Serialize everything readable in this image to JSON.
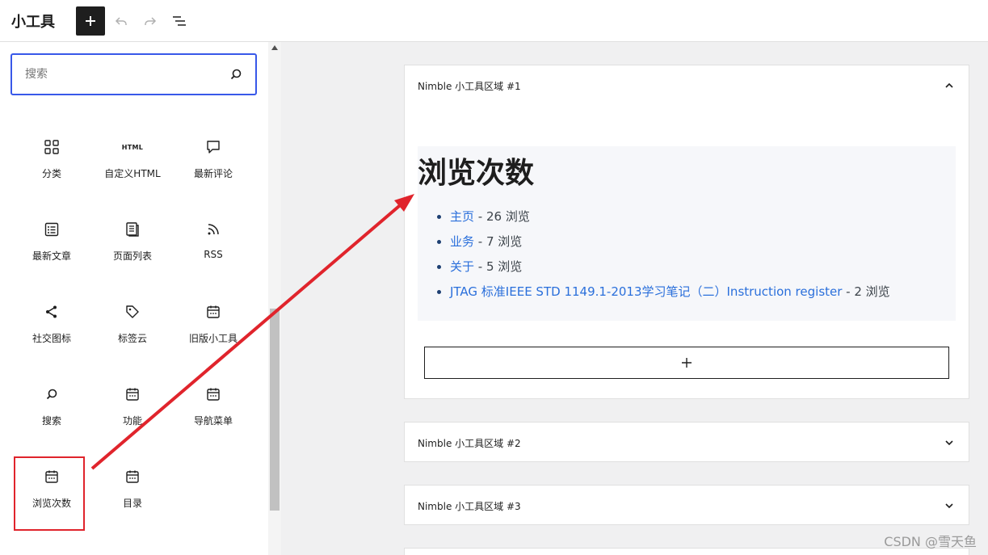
{
  "header": {
    "title": "小工具",
    "add_icon": "plus-icon",
    "undo_icon": "undo-icon",
    "redo_icon": "redo-icon",
    "list_view_icon": "list-view-icon"
  },
  "sidebar": {
    "search_placeholder": "搜索",
    "search_value": "",
    "blocks": [
      {
        "label": "分类",
        "icon": "categories-icon"
      },
      {
        "label": "自定义HTML",
        "icon": "html-icon",
        "glyph": "HTML"
      },
      {
        "label": "最新评论",
        "icon": "comment-icon"
      },
      {
        "label": "最新文章",
        "icon": "post-list-icon"
      },
      {
        "label": "页面列表",
        "icon": "pages-icon"
      },
      {
        "label": "RSS",
        "icon": "rss-icon"
      },
      {
        "label": "社交图标",
        "icon": "share-icon"
      },
      {
        "label": "标签云",
        "icon": "tag-icon"
      },
      {
        "label": "旧版小工具",
        "icon": "calendar-icon"
      },
      {
        "label": "搜索",
        "icon": "search-icon"
      },
      {
        "label": "功能",
        "icon": "calendar-icon"
      },
      {
        "label": "导航菜单",
        "icon": "calendar-icon"
      },
      {
        "label": "浏览次数",
        "icon": "calendar-icon"
      },
      {
        "label": "目录",
        "icon": "calendar-icon"
      }
    ]
  },
  "main": {
    "areas": [
      {
        "title": "Nimble 小工具区域 #1",
        "expanded": true
      },
      {
        "title": "Nimble 小工具区域 #2",
        "expanded": false
      },
      {
        "title": "Nimble 小工具区域 #3",
        "expanded": false
      }
    ],
    "widget": {
      "heading": "浏览次数",
      "items": [
        {
          "link": "主页",
          "suffix": " - 26 浏览"
        },
        {
          "link": "业务",
          "suffix": " - 7 浏览"
        },
        {
          "link": "关于",
          "suffix": " - 5 浏览"
        },
        {
          "link": "JTAG 标准IEEE STD 1149.1-2013学习笔记（二）Instruction register",
          "suffix": " - 2 浏览"
        }
      ]
    }
  },
  "watermark": "CSDN @雪天鱼",
  "colors": {
    "accent": "#3858e9",
    "highlight": "#e0242c",
    "link": "#2a6fdb"
  }
}
